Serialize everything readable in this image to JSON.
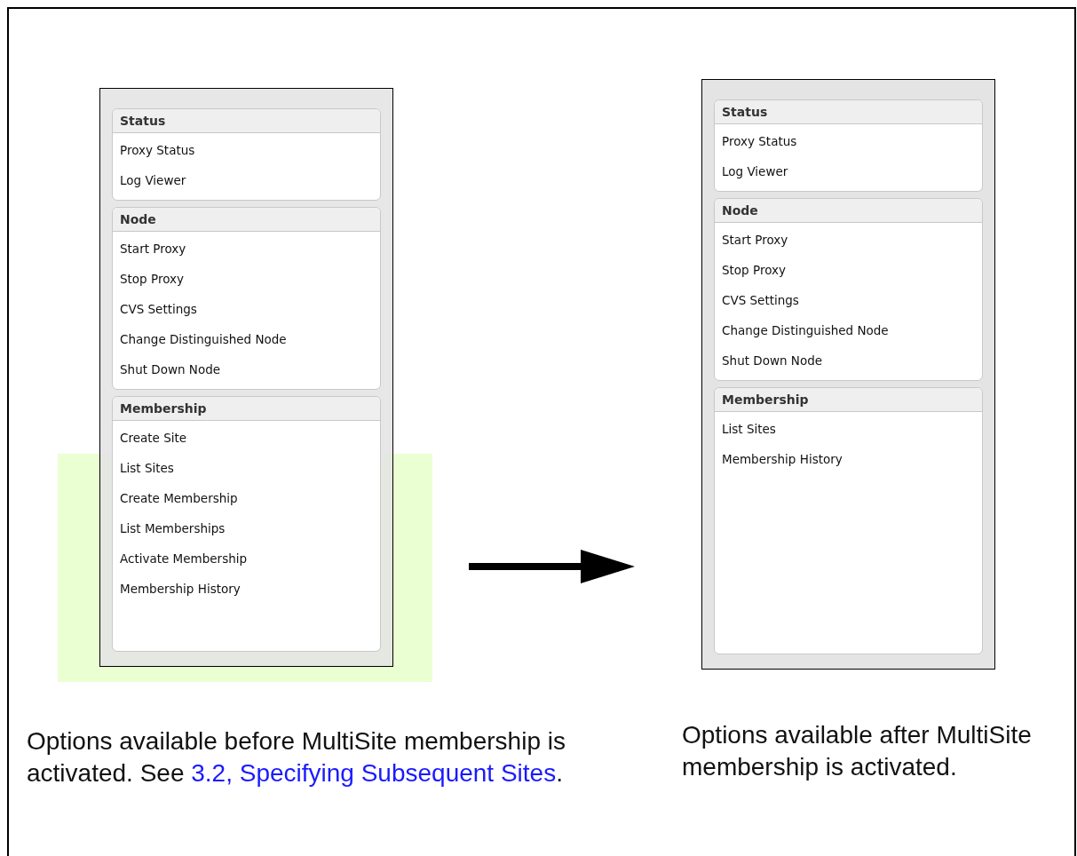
{
  "panels": [
    {
      "highlight_membership": true,
      "groups": [
        {
          "title": "Status",
          "items": [
            "Proxy Status",
            "Log Viewer"
          ]
        },
        {
          "title": "Node",
          "items": [
            "Start Proxy",
            "Stop Proxy",
            "CVS Settings",
            "Change Distinguished Node",
            "Shut Down Node"
          ]
        },
        {
          "title": "Membership",
          "items": [
            "Create Site",
            "List Sites",
            "Create Membership",
            "List Memberships",
            "Activate Membership",
            "Membership History"
          ]
        }
      ],
      "caption": {
        "text": "Options available before MultiSite membership is activated. See ",
        "link": "3.2, Specifying Subsequent Sites",
        "after": "."
      }
    },
    {
      "highlight_membership": false,
      "groups": [
        {
          "title": "Status",
          "items": [
            "Proxy Status",
            "Log Viewer"
          ]
        },
        {
          "title": "Node",
          "items": [
            "Start Proxy",
            "Stop Proxy",
            "CVS Settings",
            "Change Distinguished Node",
            "Shut Down Node"
          ]
        },
        {
          "title": "Membership",
          "items": [
            "List Sites",
            "Membership History"
          ]
        }
      ],
      "caption": {
        "text": "Options available after MultiSite membership is activated."
      }
    }
  ]
}
